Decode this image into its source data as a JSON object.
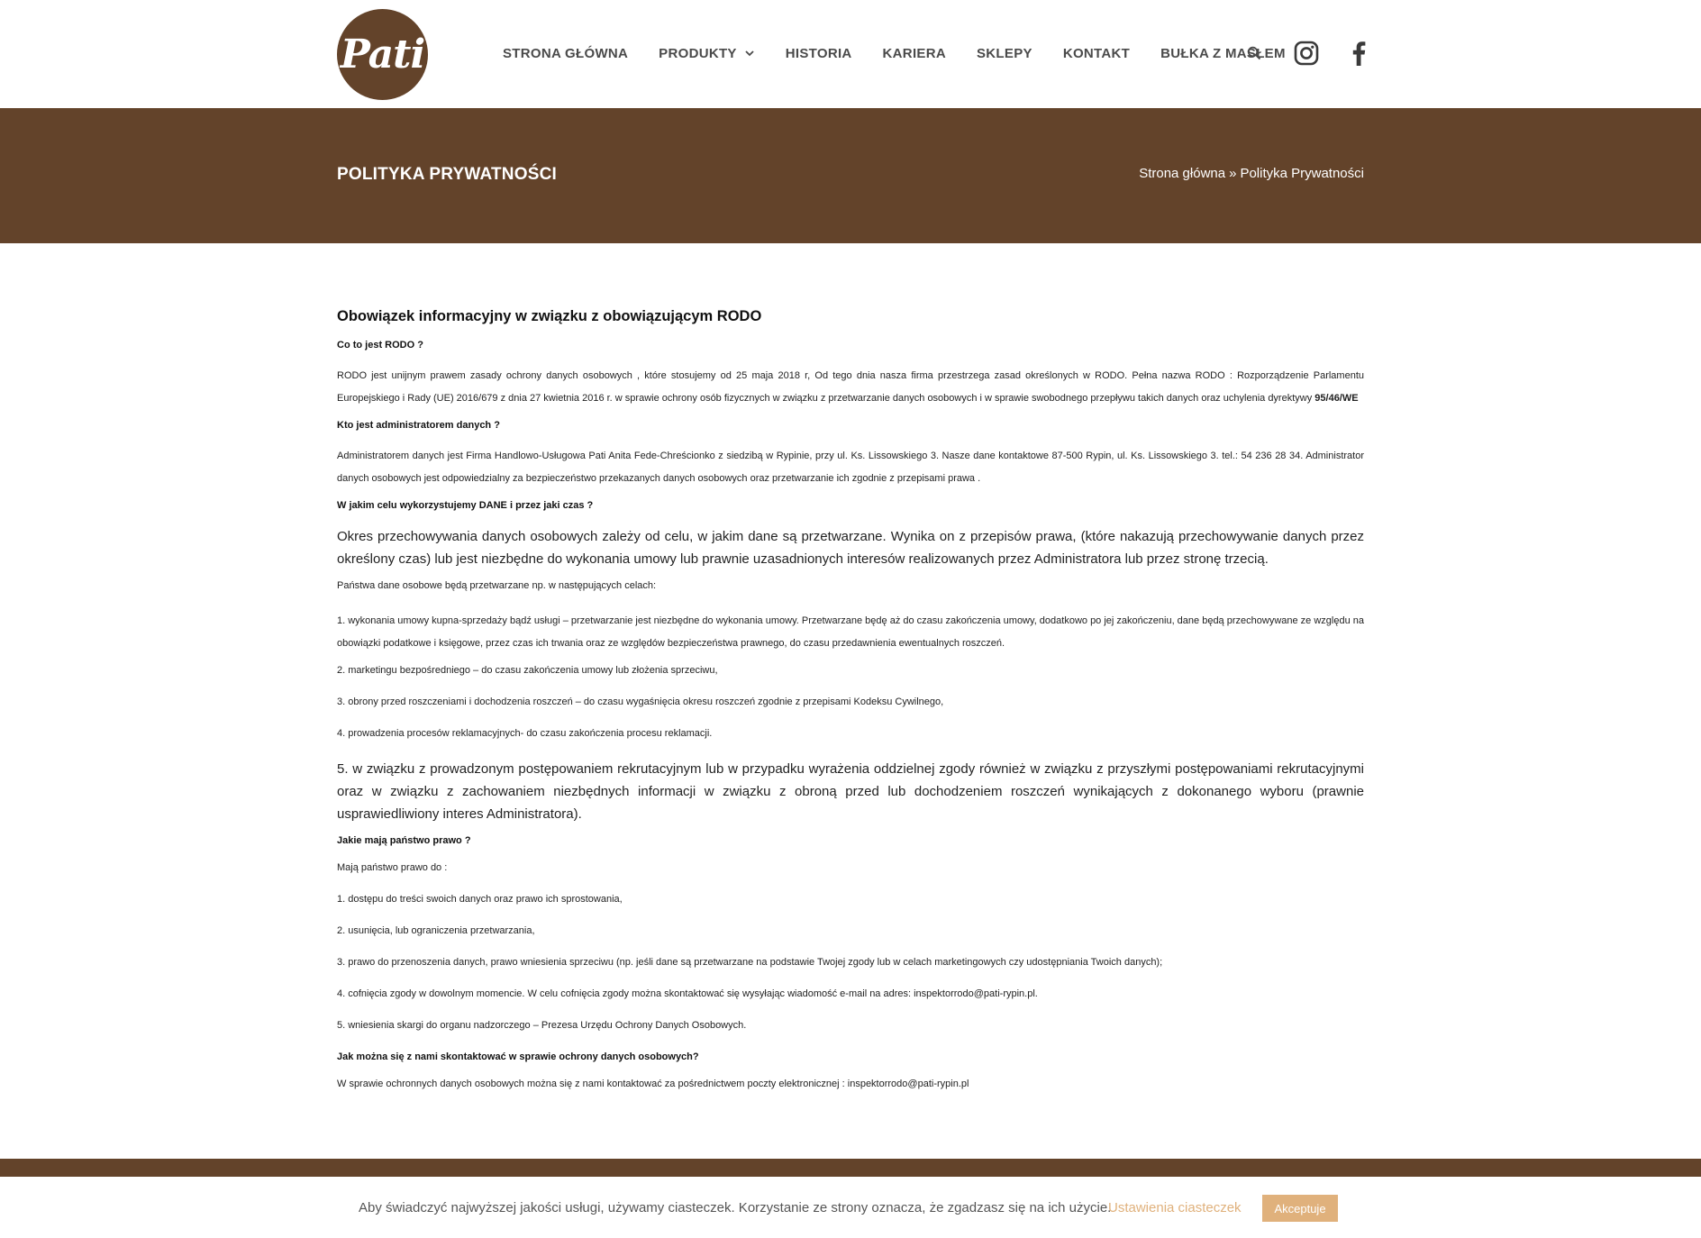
{
  "header": {
    "logo_text": "Pati",
    "nav": [
      {
        "label": "STRONA GŁÓWNA"
      },
      {
        "label": "PRODUKTY",
        "has_dropdown": true
      },
      {
        "label": "HISTORIA"
      },
      {
        "label": "KARIERA"
      },
      {
        "label": "SKLEPY"
      },
      {
        "label": "KONTAKT"
      },
      {
        "label": "BUŁKA Z MASŁEM"
      }
    ],
    "icons": [
      "search-icon",
      "instagram-icon",
      "facebook-icon"
    ]
  },
  "banner": {
    "title": "POLITYKA PRYWATNOŚCI",
    "breadcrumb_home": "Strona główna",
    "breadcrumb_sep": "»",
    "breadcrumb_current": "Polityka Prywatności"
  },
  "content": {
    "heading": "Obowiązek informacyjny w związku z obowiązującym RODO",
    "q1": "Co to jest RODO ?",
    "p1": "RODO jest unijnym prawem zasady ochrony danych osobowych , które stosujemy od 25 maja 2018 r, Od tego dnia nasza firma przestrzega zasad określonych w RODO. Pełna nazwa RODO : Rozporządzenie Parlamentu Europejskiego i Rady (UE) 2016/679 z dnia 27 kwietnia 2016 r. w sprawie ochrony osób fizycznych w związku z przetwarzanie danych osobowych i w sprawie swobodnego przepływu takich danych oraz uchylenia dyrektywy",
    "p1_bold": "95/46/WE",
    "q2": "Kto jest administratorem danych ?",
    "p2": "Administratorem danych jest Firma Handlowo-Usługowa Pati Anita Fede-Chreścionko z siedzibą w Rypinie, przy ul. Ks. Lissowskiego 3. Nasze dane kontaktowe 87-500 Rypin, ul. Ks. Lissowskiego 3. tel.: 54 236 28 34. Administrator danych osobowych jest odpowiedzialny za bezpieczeństwo przekazanych danych osobowych oraz przetwarzanie ich zgodnie z przepisami prawa .",
    "q3": "W jakim celu wykorzystujemy DANE i przez jaki czas ?",
    "p3": "Okres przechowywania danych osobowych zależy od celu, w jakim dane są przetwarzane. Wynika on z przepisów prawa, (które nakazują przechowywanie danych przez określony czas) lub jest niezbędne do wykonania umowy lub prawnie uzasadnionych interesów realizowanych przez Administratora lub przez stronę trzecią.",
    "p4": "Państwa dane osobowe będą przetwarzane np. w następujących celach:",
    "purpose1": "1. wykonania umowy kupna-sprzedaży bądź usługi – przetwarzanie jest niezbędne do wykonania umowy. Przetwarzane będę aż do czasu zakończenia umowy, dodatkowo po jej zakończeniu, dane będą przechowywane ze względu na obowiązki podatkowe i księgowe, przez czas ich trwania oraz ze względów bezpieczeństwa prawnego, do czasu przedawnienia ewentualnych roszczeń.",
    "purpose2": "2. marketingu bezpośredniego – do czasu zakończenia umowy lub złożenia sprzeciwu,",
    "purpose3": "3. obrony przed roszczeniami i dochodzenia roszczeń – do czasu wygaśnięcia okresu roszczeń zgodnie z przepisami Kodeksu Cywilnego,",
    "purpose4": "4. prowadzenia procesów reklamacyjnych- do czasu zakończenia procesu reklamacji.",
    "purpose5": "5. w związku z prowadzonym postępowaniem rekrutacyjnym lub w przypadku wyrażenia oddzielnej zgody również w związku z przyszłymi postępowaniami rekrutacyjnymi oraz w związku z zachowaniem niezbędnych informacji w związku z obroną przed lub dochodzeniem roszczeń wynikających z dokonanego wyboru (prawnie usprawiedliwiony interes Administratora).",
    "q4": "Jakie mają państwo prawo ?",
    "p5": "Mają państwo prawo do :",
    "right1": "1. dostępu do treści swoich danych oraz prawo ich sprostowania,",
    "right2": "2. usunięcia, lub ograniczenia przetwarzania,",
    "right3": "3. prawo do przenoszenia danych, prawo wniesienia sprzeciwu (np. jeśli dane są przetwarzane na podstawie Twojej zgody lub w celach marketingowych czy udostępniania Twoich danych);",
    "right4": "4. cofnięcia zgody w dowolnym momencie. W celu cofnięcia zgody można skontaktować się wysyłając wiadomość e-mail na adres: inspektorrodo@pati-rypin.pl.",
    "right5": "5. wniesienia skargi do organu nadzorczego – Prezesa Urzędu Ochrony Danych Osobowych.",
    "q5": "Jak można się z nami skontaktować w sprawie ochrony danych osobowych?",
    "p6": "W sprawie ochronnych danych osobowych można się z nami kontaktować za pośrednictwem poczty elektronicznej : inspektorrodo@pati-rypin.pl"
  },
  "cookie": {
    "text": "Aby świadczyć najwyższej jakości usługi, używamy ciasteczek. Korzystanie ze strony oznacza, że zgadzasz się na ich użycie.",
    "settings_label": "Ustawienia ciasteczek",
    "accept_label": "Akceptuje"
  },
  "colors": {
    "brand_brown": "#63432a",
    "cookie_accent": "#e0b17c",
    "nav_text": "#4a4a4a"
  }
}
